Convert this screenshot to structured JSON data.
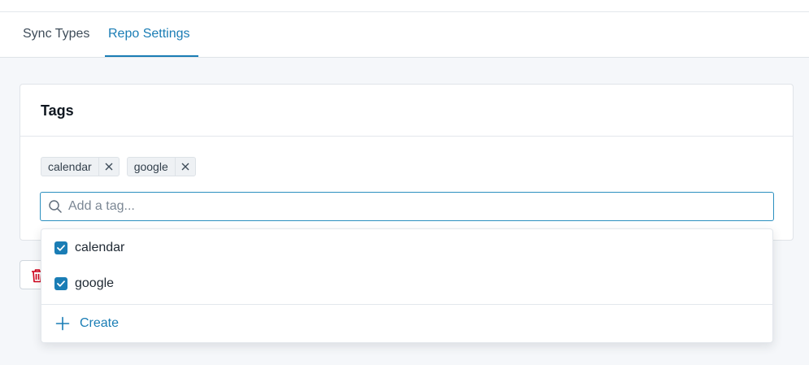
{
  "tabs": [
    {
      "label": "Sync Types",
      "active": false
    },
    {
      "label": "Repo Settings",
      "active": true
    }
  ],
  "card": {
    "title": "Tags",
    "chips": [
      {
        "label": "calendar"
      },
      {
        "label": "google"
      }
    ],
    "search": {
      "placeholder": "Add a tag...",
      "value": ""
    }
  },
  "dropdown": {
    "options": [
      {
        "label": "calendar",
        "checked": true
      },
      {
        "label": "google",
        "checked": true
      }
    ],
    "create_label": "Create"
  },
  "icons": {
    "search": "search-icon",
    "remove": "close-icon",
    "check": "checkmark-icon",
    "plus": "plus-icon",
    "trash": "trash-icon"
  },
  "colors": {
    "accent": "#1a7db5",
    "danger": "#d0021b",
    "page_background": "#f5f7fa"
  }
}
